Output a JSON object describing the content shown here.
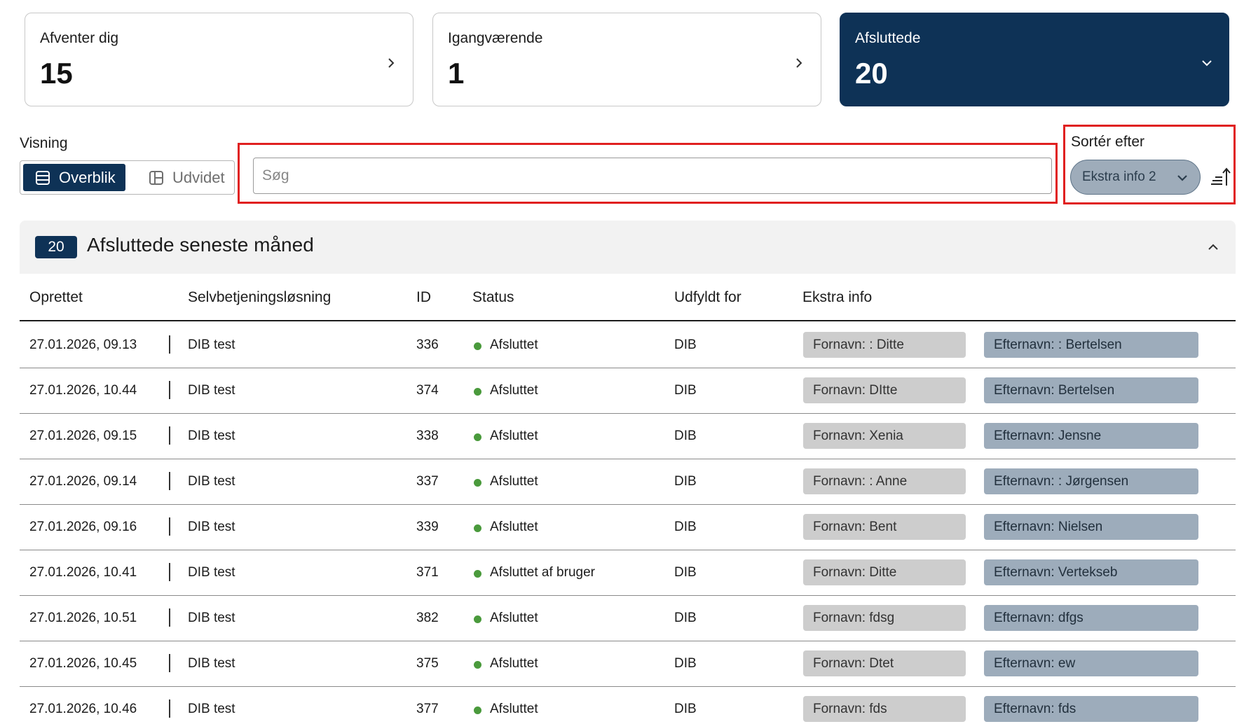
{
  "summary_cards": [
    {
      "label": "Afventer dig",
      "count": "15"
    },
    {
      "label": "Igangværende",
      "count": "1"
    },
    {
      "label": "Afsluttede",
      "count": "20"
    }
  ],
  "view": {
    "label": "Visning",
    "options": [
      "Overblik",
      "Udvidet"
    ],
    "selected": "Overblik"
  },
  "search": {
    "placeholder": "Søg",
    "value": ""
  },
  "sort": {
    "label": "Sortér efter",
    "selected": "Ekstra info 2"
  },
  "group": {
    "count": "20",
    "title": "Afsluttede seneste måned",
    "columns": [
      "Oprettet",
      "Selvbetjeningsløsning",
      "ID",
      "Status",
      "Udfyldt for",
      "Ekstra info"
    ],
    "rows": [
      {
        "created": "27.01.2026, 09.13",
        "solution": "DIB test",
        "id": "336",
        "status": "Afsluttet",
        "filled_for": "DIB",
        "info1": "Fornavn: : Ditte",
        "info2": "Efternavn: : Bertelsen"
      },
      {
        "created": "27.01.2026, 10.44",
        "solution": "DIB test",
        "id": "374",
        "status": "Afsluttet",
        "filled_for": "DIB",
        "info1": "Fornavn: DItte",
        "info2": "Efternavn: Bertelsen"
      },
      {
        "created": "27.01.2026, 09.15",
        "solution": "DIB test",
        "id": "338",
        "status": "Afsluttet",
        "filled_for": "DIB",
        "info1": "Fornavn: Xenia",
        "info2": "Efternavn: Jensne"
      },
      {
        "created": "27.01.2026, 09.14",
        "solution": "DIB test",
        "id": "337",
        "status": "Afsluttet",
        "filled_for": "DIB",
        "info1": "Fornavn: : Anne",
        "info2": "Efternavn: : Jørgensen"
      },
      {
        "created": "27.01.2026, 09.16",
        "solution": "DIB test",
        "id": "339",
        "status": "Afsluttet",
        "filled_for": "DIB",
        "info1": "Fornavn: Bent",
        "info2": "Efternavn: Nielsen"
      },
      {
        "created": "27.01.2026, 10.41",
        "solution": "DIB test",
        "id": "371",
        "status": "Afsluttet af bruger",
        "filled_for": "DIB",
        "info1": "Fornavn: Ditte",
        "info2": "Efternavn: Vertekseb"
      },
      {
        "created": "27.01.2026, 10.51",
        "solution": "DIB test",
        "id": "382",
        "status": "Afsluttet",
        "filled_for": "DIB",
        "info1": "Fornavn: fdsg",
        "info2": "Efternavn: dfgs"
      },
      {
        "created": "27.01.2026, 10.45",
        "solution": "DIB test",
        "id": "375",
        "status": "Afsluttet",
        "filled_for": "DIB",
        "info1": "Fornavn: Dtet",
        "info2": "Efternavn: ew"
      },
      {
        "created": "27.01.2026, 10.46",
        "solution": "DIB test",
        "id": "377",
        "status": "Afsluttet",
        "filled_for": "DIB",
        "info1": "Fornavn: fds",
        "info2": "Efternavn: fds"
      }
    ]
  },
  "colors": {
    "accent": "#0e3256",
    "status_dot": "#4a9a3c",
    "highlight_frame": "#e02020",
    "pill_grey": "#cdcdcd",
    "pill_blue": "#9dacbb"
  }
}
